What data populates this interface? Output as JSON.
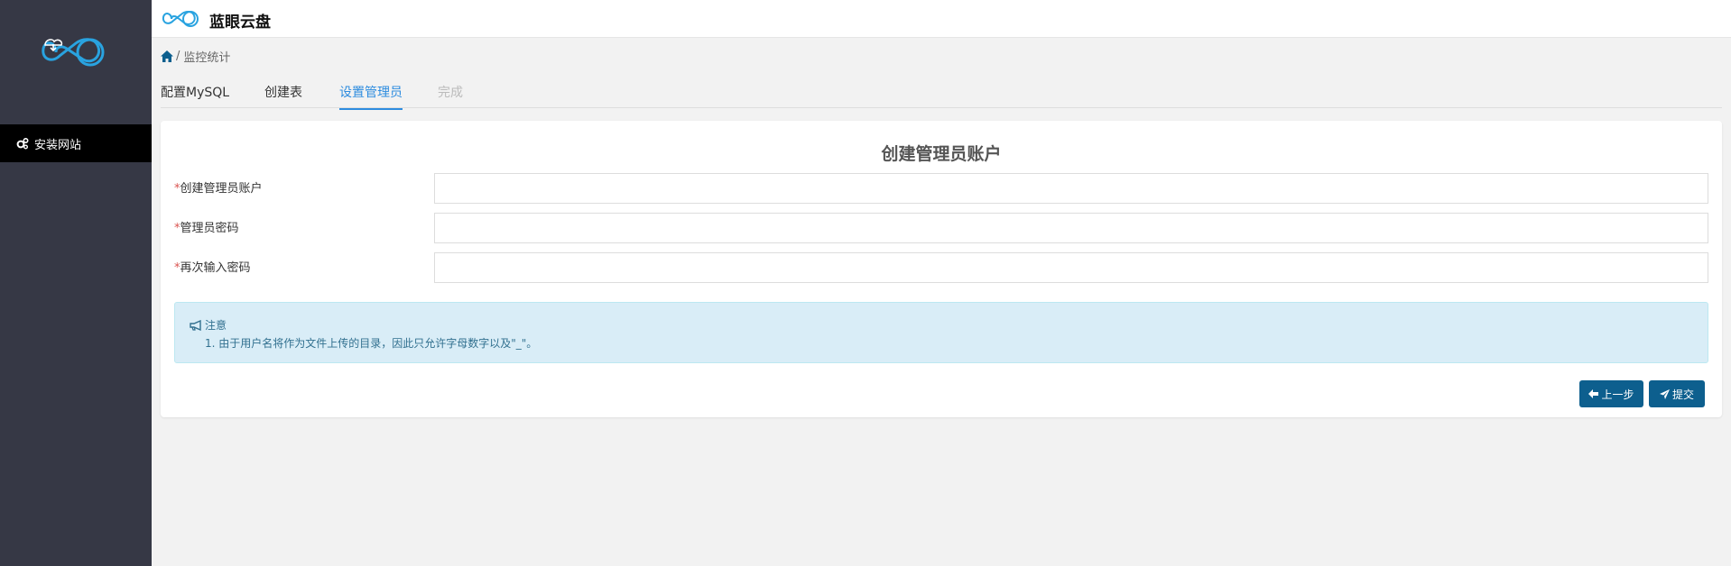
{
  "app": {
    "name": "蓝眼云盘"
  },
  "sidebar": {
    "items": [
      {
        "label": "安装网站",
        "icon": "cogs-icon"
      }
    ]
  },
  "breadcrumb": {
    "separator": "/",
    "current": "监控统计"
  },
  "tabs": [
    {
      "label": "配置MySQL",
      "state": "done"
    },
    {
      "label": "创建表",
      "state": "done"
    },
    {
      "label": "设置管理员",
      "state": "active"
    },
    {
      "label": "完成",
      "state": "disabled"
    }
  ],
  "form": {
    "title": "创建管理员账户",
    "required_mark": "*",
    "fields": [
      {
        "label": "创建管理员账户",
        "value": ""
      },
      {
        "label": "管理员密码",
        "value": ""
      },
      {
        "label": "再次输入密码",
        "value": ""
      }
    ]
  },
  "notice": {
    "title": "注意",
    "lines": [
      "1. 由于用户名将作为文件上传的目录，因此只允许字母数字以及\"_\"。"
    ]
  },
  "buttons": {
    "prev": "上一步",
    "submit": "提交"
  },
  "colors": {
    "accent": "#2d8cdf",
    "sidebar": "#363845",
    "button": "#0d5f8e",
    "notice_bg": "#d9edf7"
  }
}
